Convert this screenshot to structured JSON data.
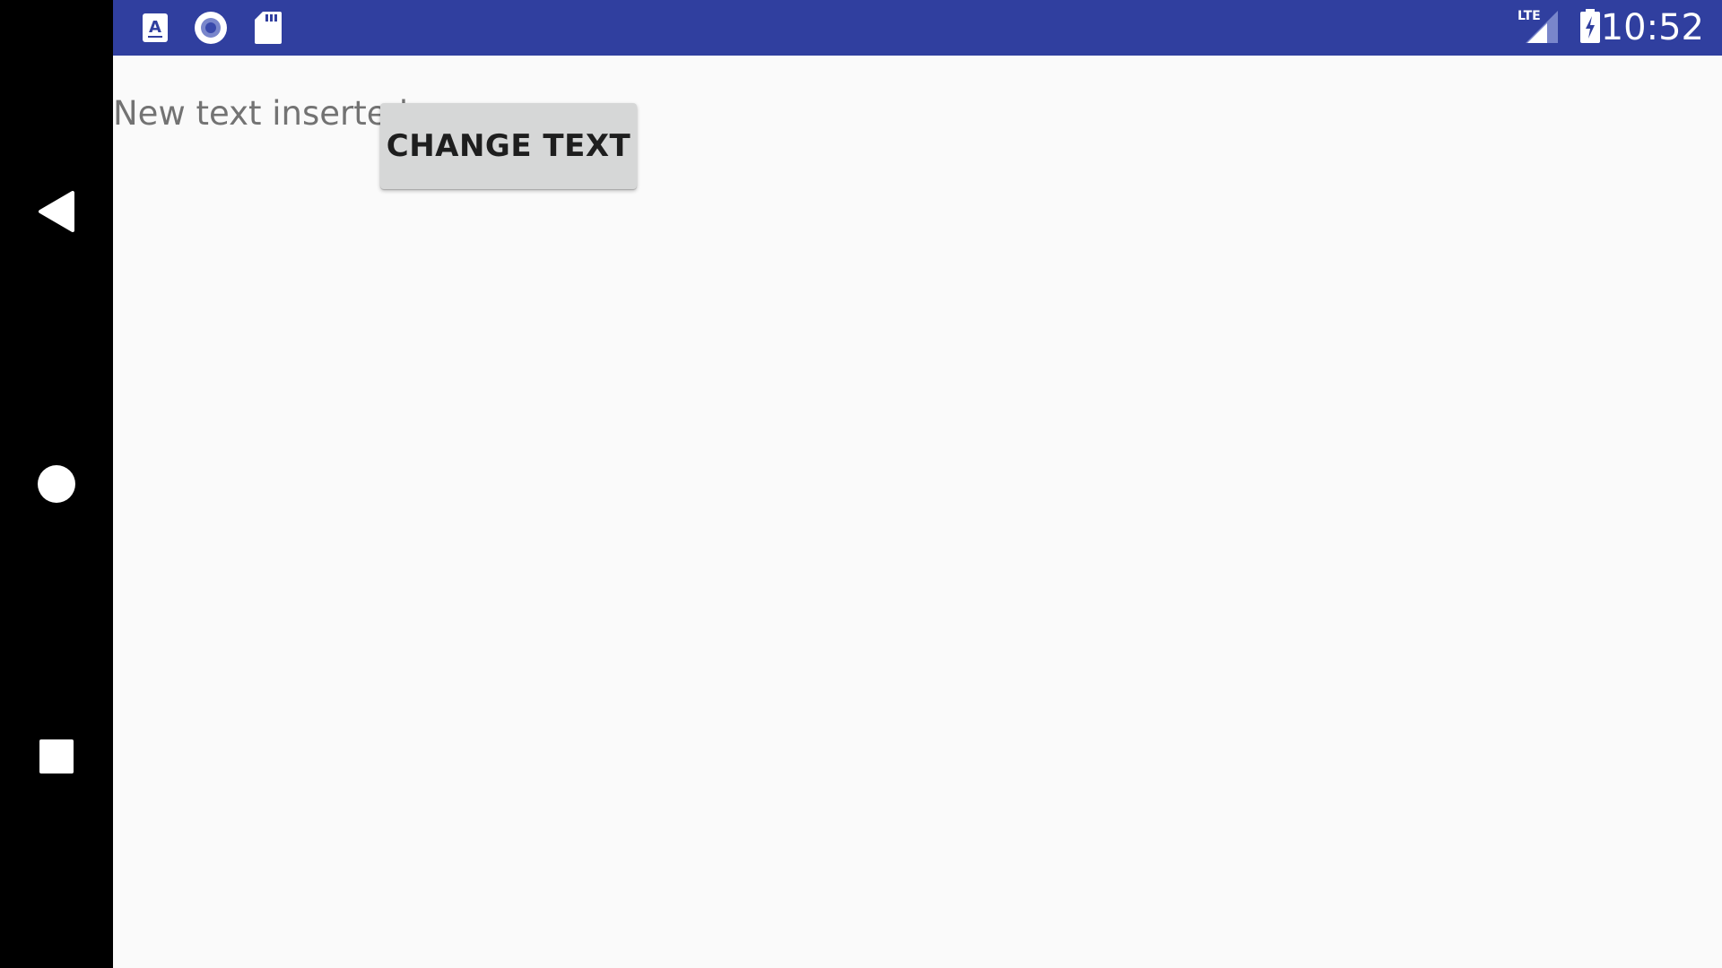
{
  "status_bar": {
    "notification_icons": [
      "accessibility-a-icon",
      "record-circle-icon",
      "sd-card-icon"
    ],
    "network_type": "LTE",
    "time": "10:52",
    "background_color": "#303f9f"
  },
  "navigation_bar": {
    "buttons": [
      "back-triangle-icon",
      "home-circle-icon",
      "recents-square-icon"
    ]
  },
  "main": {
    "text_view": "New text inserted",
    "change_text_button": "CHANGE TEXT"
  }
}
